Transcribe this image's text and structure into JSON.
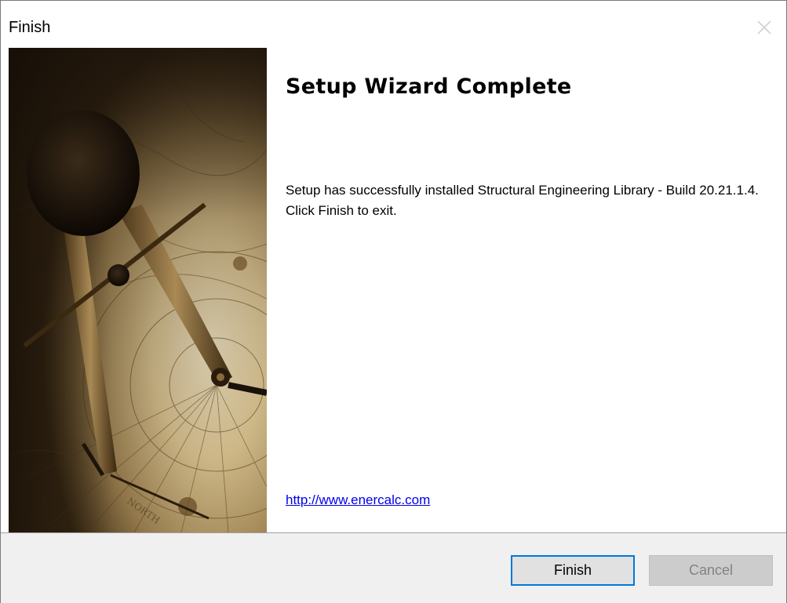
{
  "window": {
    "title": "Finish"
  },
  "content": {
    "heading": "Setup Wizard Complete",
    "message": "Setup has successfully installed Structural Engineering Library - Build 20.21.1.4. Click Finish to exit.",
    "link": "http://www.enercalc.com"
  },
  "buttons": {
    "finish": "Finish",
    "cancel": "Cancel"
  },
  "colors": {
    "link": "#0000ee",
    "default_button_border": "#0078d7",
    "footer_bg": "#f0f0f0",
    "disabled_text": "#838383"
  },
  "icons": {
    "close": "close-icon",
    "banner": "compass-map-banner"
  }
}
